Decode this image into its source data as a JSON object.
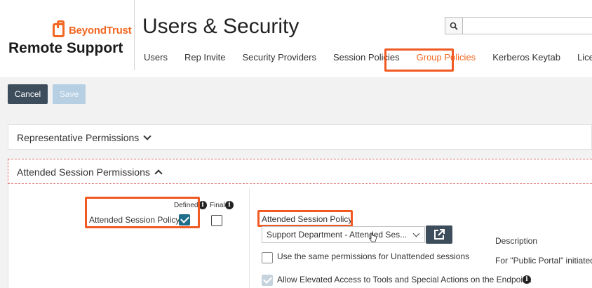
{
  "brand": {
    "logo_text": "BeyondTrust",
    "product": "Remote Support"
  },
  "page": {
    "title": "Users & Security"
  },
  "search": {
    "placeholder": "",
    "icon": "search-icon"
  },
  "tabs": [
    {
      "label": "Users",
      "active": false
    },
    {
      "label": "Rep Invite",
      "active": false
    },
    {
      "label": "Security Providers",
      "active": false
    },
    {
      "label": "Session Policies",
      "active": false
    },
    {
      "label": "Group Policies",
      "active": true
    },
    {
      "label": "Kerberos Keytab",
      "active": false
    },
    {
      "label": "Licensing",
      "active": false
    }
  ],
  "toolbar": {
    "cancel_label": "Cancel",
    "save_label": "Save"
  },
  "sections": {
    "representative": {
      "label": "Representative Permissions",
      "expanded": false
    },
    "attended": {
      "label": "Attended Session Permissions",
      "expanded": true
    }
  },
  "attended_panel": {
    "defined_label": "Defined",
    "final_label": "Final",
    "policy_row_label": "Attended Session Policy",
    "defined_checked": true,
    "final_checked": false,
    "policy_header": "Attended Session Policy",
    "policy_select_value": "Support Department - Attended Ses...",
    "description_label": "Description",
    "description_value": "For \"Public Portal\" initiated",
    "same_perms_label": "Use the same permissions for Unattended sessions",
    "same_perms_checked": false,
    "elevated_label": "Allow Elevated Access to Tools and Special Actions on the Endpoint.",
    "elevated_checked": true
  },
  "colors": {
    "accent": "#f26722",
    "highlight": "#f15a22",
    "primary_button": "#3d4d5c",
    "checkbox_checked": "#1f6f8b"
  }
}
